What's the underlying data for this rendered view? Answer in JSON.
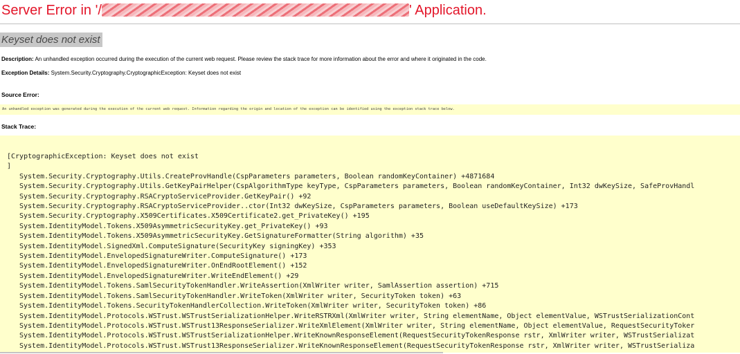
{
  "page": {
    "title_prefix": "Server Error in '/",
    "title_suffix": "' Application.",
    "error_title": "Keyset does not exist",
    "description_label": "Description:",
    "description_text": "An unhandled exception occurred during the execution of the current web request. Please review the stack trace for more information about the error and where it originated in the code.",
    "exception_label": "Exception Details:",
    "exception_text": "System.Security.Cryptography.CryptographicException: Keyset does not exist",
    "source_error_heading": "Source Error:",
    "source_error_text": "An unhandled exception was generated during the execution of the current web request. Information regarding the origin and location of the exception can be identified using the exception stack trace below.",
    "stack_trace_heading": "Stack Trace:"
  },
  "stack": {
    "header": "[CryptographicException: Keyset does not exist",
    "close": "]",
    "frames": [
      "System.Security.Cryptography.Utils.CreateProvHandle(CspParameters parameters, Boolean randomKeyContainer) +4871684",
      "System.Security.Cryptography.Utils.GetKeyPairHelper(CspAlgorithmType keyType, CspParameters parameters, Boolean randomKeyContainer, Int32 dwKeySize, SafeProvHandl",
      "System.Security.Cryptography.RSACryptoServiceProvider.GetKeyPair() +92",
      "System.Security.Cryptography.RSACryptoServiceProvider..ctor(Int32 dwKeySize, CspParameters parameters, Boolean useDefaultKeySize) +173",
      "System.Security.Cryptography.X509Certificates.X509Certificate2.get_PrivateKey() +195",
      "System.IdentityModel.Tokens.X509AsymmetricSecurityKey.get_PrivateKey() +93",
      "System.IdentityModel.Tokens.X509AsymmetricSecurityKey.GetSignatureFormatter(String algorithm) +35",
      "System.IdentityModel.SignedXml.ComputeSignature(SecurityKey signingKey) +353",
      "System.IdentityModel.EnvelopedSignatureWriter.ComputeSignature() +173",
      "System.IdentityModel.EnvelopedSignatureWriter.OnEndRootElement() +152",
      "System.IdentityModel.EnvelopedSignatureWriter.WriteEndElement() +29",
      "System.IdentityModel.Tokens.SamlSecurityTokenHandler.WriteAssertion(XmlWriter writer, SamlAssertion assertion) +715",
      "System.IdentityModel.Tokens.SamlSecurityTokenHandler.WriteToken(XmlWriter writer, SecurityToken token) +63",
      "System.IdentityModel.Tokens.SecurityTokenHandlerCollection.WriteToken(XmlWriter writer, SecurityToken token) +86",
      "System.IdentityModel.Protocols.WSTrust.WSTrustSerializationHelper.WriteRSTRXml(XmlWriter writer, String elementName, Object elementValue, WSTrustSerializationCont",
      "System.IdentityModel.Protocols.WSTrust.WSTrust13ResponseSerializer.WriteXmlElement(XmlWriter writer, String elementName, Object elementValue, RequestSecurityToker",
      "System.IdentityModel.Protocols.WSTrust.WSTrustSerializationHelper.WriteKnownResponseElement(RequestSecurityTokenResponse rstr, XmlWriter writer, WSTrustSerializat",
      "System.IdentityModel.Protocols.WSTrust.WSTrust13ResponseSerializer.WriteKnownResponseElement(RequestSecurityTokenResponse rstr, XmlWriter writer, WSTrustSerializa"
    ]
  }
}
